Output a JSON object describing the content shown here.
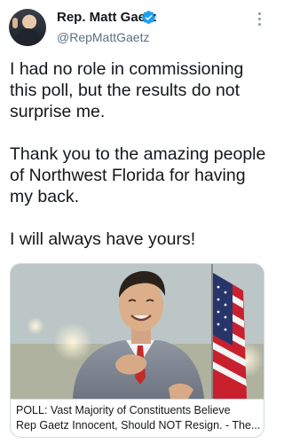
{
  "tweet": {
    "author": {
      "name": "Rep. Matt Gaetz",
      "handle": "@RepMattGaetz",
      "verified": true,
      "avatar_icon": "profile-photo"
    },
    "menu_icon": "more-vertical-icon",
    "text_lines": [
      "I had no role in commissioning",
      "this poll, but the results do not",
      "surprise me.",
      "",
      "Thank you to the amazing people",
      "of Northwest Florida for having",
      "my back.",
      "",
      "I will always have yours!"
    ],
    "link_card": {
      "image": "photo-man-hand-on-chest-american-flag",
      "title_line_1": "POLL: Vast Majority of Constituents Believe",
      "title_line_2": "Rep Gaetz Innocent, Should NOT Resign. - The..."
    }
  },
  "colors": {
    "text": "#14171a",
    "secondary_text": "#5b7083",
    "verified_badge": "#1da1f2",
    "border": "#cfd9de"
  }
}
